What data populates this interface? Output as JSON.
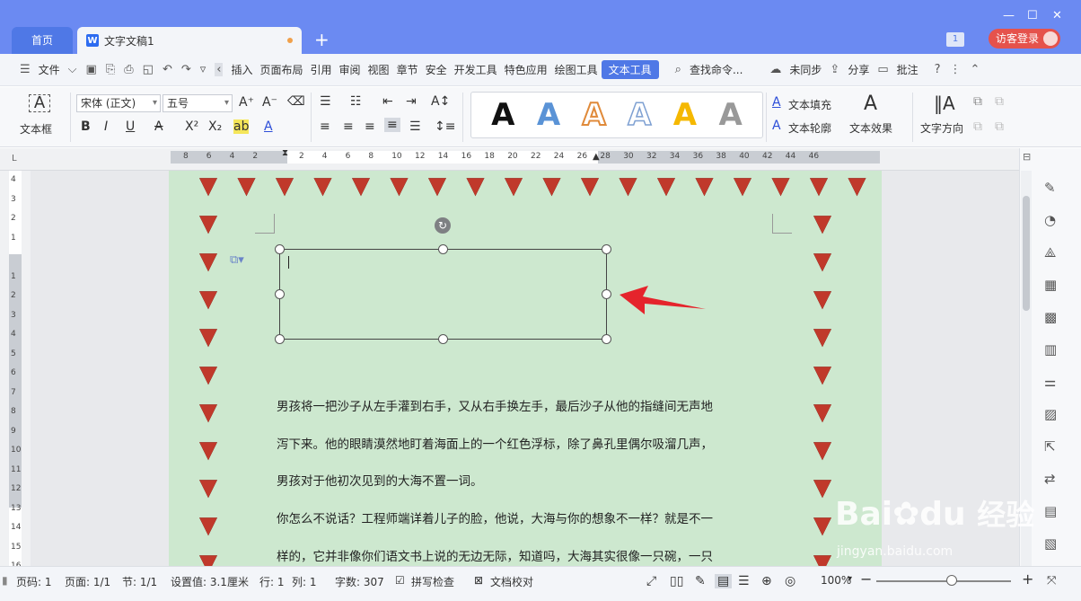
{
  "titlebar": {
    "home_tab": "首页",
    "doc_tab": "文字文稿1",
    "badge": "1",
    "login": "访客登录"
  },
  "menu": {
    "file": "文件",
    "items": [
      "插入",
      "页面布局",
      "引用",
      "审阅",
      "视图",
      "章节",
      "安全",
      "开发工具",
      "特色应用",
      "绘图工具"
    ],
    "active": "文本工具",
    "search": "查找命令...",
    "sync": "未同步",
    "share": "分享",
    "comment": "批注"
  },
  "ribbon": {
    "textbox_label": "文本框",
    "font_name": "宋体 (正文)",
    "font_size": "五号",
    "text_fill": "文本填充",
    "text_outline": "文本轮廓",
    "text_effect": "文本效果",
    "text_direction": "文字方向",
    "style_letters": [
      "A",
      "A",
      "A",
      "A",
      "A",
      "A"
    ]
  },
  "ruler": {
    "h_ticks": [
      "8",
      "6",
      "4",
      "2",
      "",
      "2",
      "4",
      "6",
      "8",
      "10",
      "12",
      "14",
      "16",
      "18",
      "20",
      "22",
      "24",
      "26",
      "28",
      "30",
      "32",
      "34",
      "36",
      "38",
      "40",
      "42",
      "44",
      "46"
    ],
    "v_ticks": [
      "4",
      "3",
      "2",
      "1",
      "",
      "1",
      "2",
      "3",
      "4",
      "5",
      "6",
      "7",
      "8",
      "9",
      "10",
      "11",
      "12",
      "13",
      "14",
      "15",
      "16"
    ]
  },
  "document": {
    "paragraphs": [
      "男孩将一把沙子从左手灌到右手，又从右手换左手，最后沙子从他的指缝间无声地",
      "泻下来。他的眼睛漠然地盯着海面上的一个红色浮标，除了鼻孔里偶尔吸溜几声，",
      "男孩对于他初次见到的大海不置一词。",
      "你怎么不说话？工程师端详着儿子的脸，他说，大海与你的想象不一样？就是不一",
      "样的，它并非像你们语文书上说的无边无际，知道吗，大海其实很像一只碗，一只"
    ]
  },
  "status": {
    "page_num": "页码: 1",
    "pages": "页面: 1/1",
    "section": "节: 1/1",
    "setting": "设置值: 3.1厘米",
    "row": "行: 1",
    "col": "列: 1",
    "words": "字数: 307",
    "spell": "拼写检查",
    "proof": "文档校对",
    "zoom": "100%"
  },
  "watermark": {
    "brand": "Bai",
    "brand2": "du",
    "cn": "经验",
    "url": "jingyan.baidu.com"
  },
  "colors": {
    "titlebar": "#6b8af2",
    "accent": "#4f78e6",
    "page_bg": "#cde8cf",
    "arrow": "#e5242c",
    "login": "#e5524c"
  }
}
